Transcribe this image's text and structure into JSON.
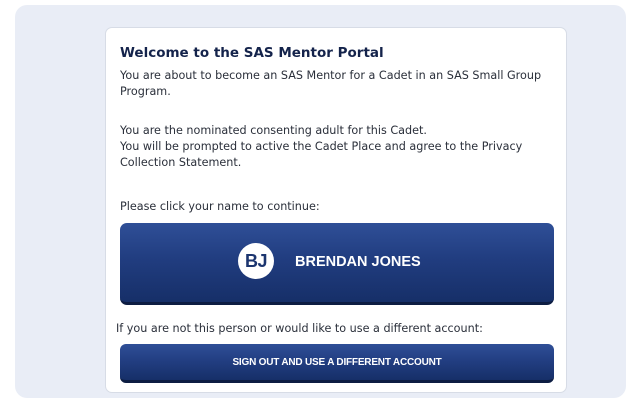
{
  "welcome": {
    "title": "Welcome to the SAS Mentor Portal",
    "intro": "You are about to become an SAS Mentor for a Cadet in an SAS Small Group Program.",
    "line2a": "You are the nominated consenting adult for this Cadet.",
    "line2b": "You will be prompted to active the Cadet Place and agree to the Privacy Collection Statement.",
    "prompt": "Please click your name to continue:"
  },
  "user": {
    "initials": "BJ",
    "name": "BRENDAN JONES"
  },
  "alternate": {
    "text": "If you are not this person or would like to use a different account:",
    "button_label": "SIGN OUT AND USE A DIFFERENT ACCOUNT"
  },
  "colors": {
    "button_primary": "#213d80",
    "panel_background": "#e9edf6",
    "title_text": "#14234b"
  }
}
